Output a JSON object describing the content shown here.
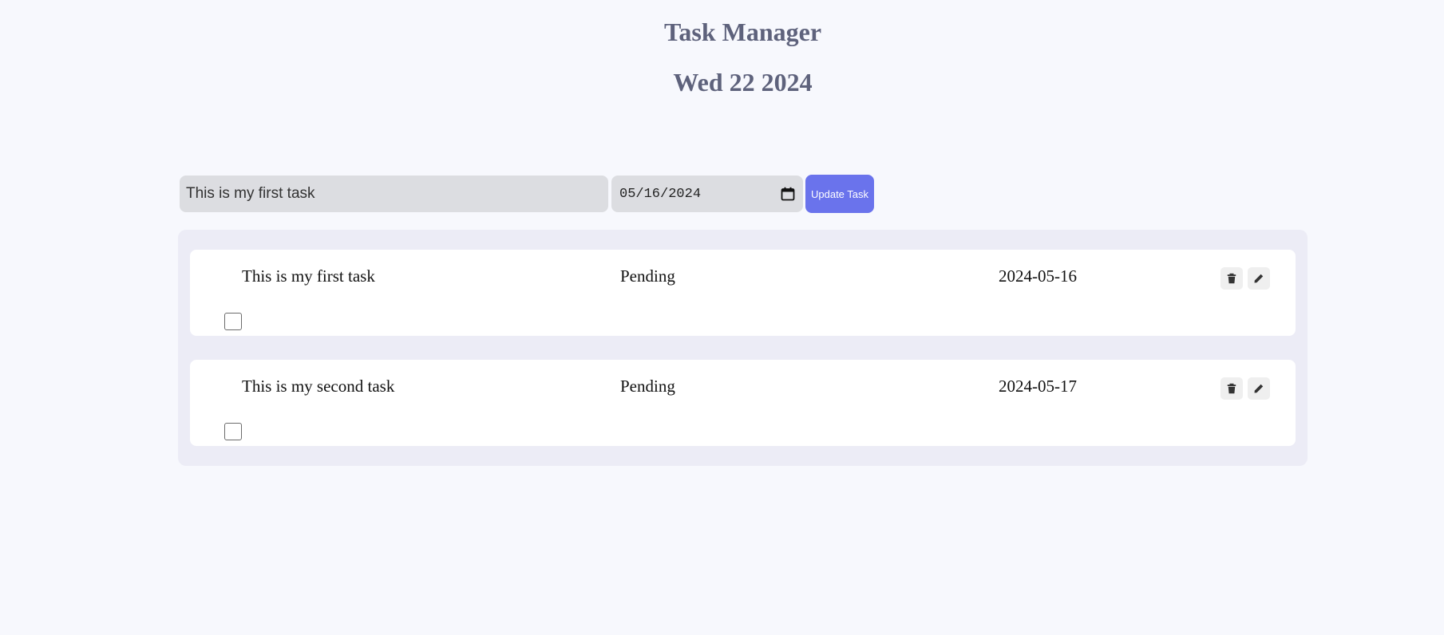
{
  "header": {
    "title": "Task Manager",
    "date": "Wed 22 2024"
  },
  "form": {
    "task_value": "This is my first task",
    "date_value": "05/16/2024",
    "submit_label": "Update Task",
    "date_icon": "calendar-icon"
  },
  "tasks": [
    {
      "text": "This is my first task",
      "status": "Pending",
      "date": "2024-05-16",
      "checked": false,
      "actions": [
        "trash-icon",
        "pencil-icon"
      ]
    },
    {
      "text": "This is my second task",
      "status": "Pending",
      "date": "2024-05-17",
      "checked": false,
      "actions": [
        "trash-icon",
        "pencil-icon"
      ]
    }
  ],
  "colors": {
    "background": "#f7f8fd",
    "heading": "#5e627c",
    "accent": "#6a73ec",
    "input_bg": "#dcdde1",
    "list_bg": "#ececf6",
    "card_bg": "#ffffff",
    "icon_button_bg": "#efefef"
  }
}
